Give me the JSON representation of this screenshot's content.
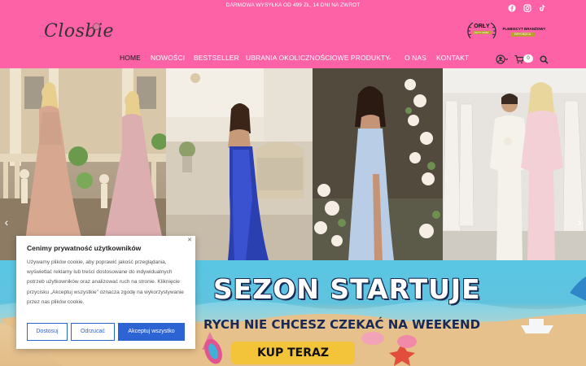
{
  "topbar": {
    "announcement": "DARMOWA WYSYŁKA OD 499 ZŁ, 14 DNI NA ZWROT",
    "social": [
      "facebook-icon",
      "instagram-icon",
      "tiktok-icon"
    ]
  },
  "brand": {
    "logo_text": "Closbie",
    "award_text": "PLEBISCYT BRANŻOWY",
    "award_badge": "ZWYCIĘZCA"
  },
  "nav": {
    "items": [
      "HOME",
      "NOWOŚCI",
      "BESTSELLER",
      "UBRANIA OKOLICZNOŚCIOWE",
      "PRODUKTY",
      "O NAS",
      "KONTAKT"
    ],
    "cart_count": "0"
  },
  "hero": {
    "banner_title": "SEZON STARTUJE",
    "banner_subtitle": "RYCH NIE CHCESZ CZEKAĆ NA WEEKEND",
    "cta": "KUP TERAZ"
  },
  "cookie": {
    "title": "Cenimy prywatność użytkowników",
    "text": "Używamy plików cookie, aby poprawić jakość przeglądania, wyświetlać reklamy lub treści dostosowane do indywidualnych potrzeb użytkowników oraz analizować ruch na stronie. Kliknięcie przycisku „Akceptuj wszystkie” oznacza zgodę na wykorzystywanie przez nas plików cookie.",
    "buttons": [
      "Dostosuj",
      "Odrzucać",
      "Akceptuj wszystko"
    ]
  },
  "colors": {
    "header_bg": "#fd62a6",
    "primary_button": "#2d64d4",
    "cta": "#f3c33a"
  }
}
